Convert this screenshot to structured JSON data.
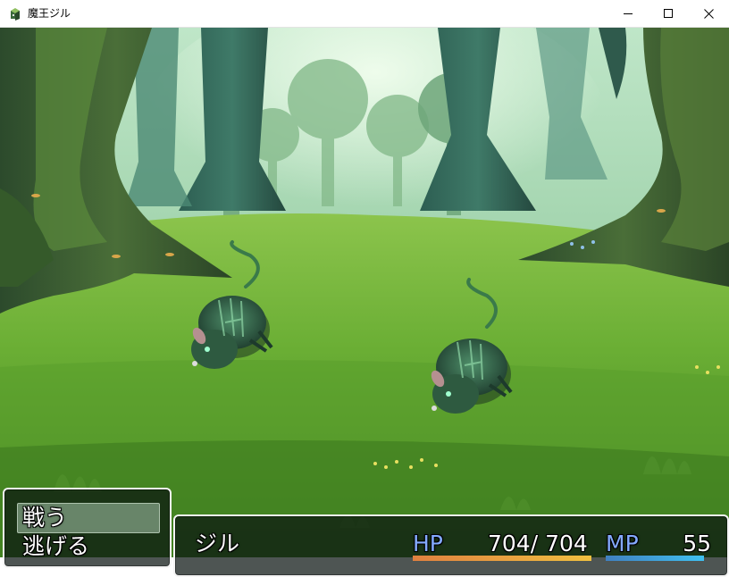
{
  "window": {
    "title": "魔王ジル",
    "icon": "game-app-icon",
    "controls": [
      "minimize-icon",
      "maximize-icon",
      "close-icon"
    ]
  },
  "battle": {
    "background": "forest-clearing",
    "enemies": [
      {
        "kind": "green-rat-monster"
      },
      {
        "kind": "green-rat-monster"
      }
    ]
  },
  "party_command": {
    "selected": "fight",
    "fight_label": "戦う",
    "escape_label": "逃げる"
  },
  "status": {
    "actor_name": "ジル",
    "hp_label": "HP",
    "hp_value": "704/ 704",
    "hp_ratio": 1.0,
    "mp_label": "MP",
    "mp_value": "55",
    "colors": {
      "system_label": "#84aaff",
      "text": "#ffffff"
    }
  }
}
